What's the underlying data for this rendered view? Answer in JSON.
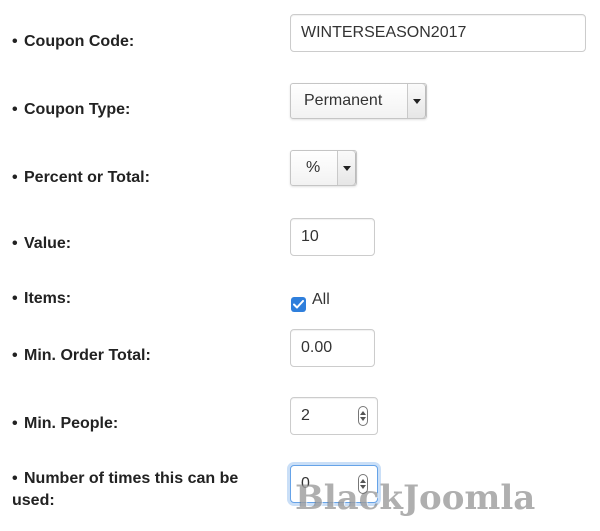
{
  "form": {
    "coupon_code": {
      "label": "Coupon Code:",
      "value": "WINTERSEASON2017"
    },
    "coupon_type": {
      "label": "Coupon Type:",
      "selected": "Permanent"
    },
    "percent_or_total": {
      "label": "Percent or Total:",
      "selected": "%"
    },
    "value": {
      "label": "Value:",
      "value": "10"
    },
    "items": {
      "label": "Items:",
      "checkbox_label": "All",
      "checked": true
    },
    "min_order_total": {
      "label": "Min. Order Total:",
      "value": "0.00"
    },
    "min_people": {
      "label": "Min. People:",
      "value": "2"
    },
    "times_used": {
      "label": "Number of times this can be used:",
      "value": "0"
    }
  },
  "bullet": "•",
  "watermark": "BlackJoomla",
  "colors": {
    "checkbox": "#2f7fdc",
    "focus": "#66a3e8",
    "border": "#cccccc"
  },
  "icons": {
    "select_arrow": "triangle-down-icon",
    "spinner": "up-down-arrows-icon",
    "checkmark": "checkmark-icon"
  }
}
